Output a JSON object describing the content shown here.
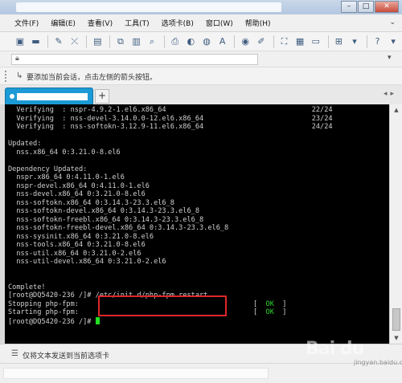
{
  "window": {
    "minimize": "–",
    "maximize": "□",
    "close": "✕"
  },
  "menu": {
    "items": [
      "文件(F)",
      "编辑(E)",
      "查看(V)",
      "工具(T)",
      "选项卡(B)",
      "窗口(W)",
      "帮助(H)"
    ]
  },
  "toolbar": {
    "icons": [
      "new-session-icon",
      "open-folder-icon",
      "reconnect-icon",
      "disconnect-icon",
      "session-properties-icon",
      "copy-icon",
      "paste-icon",
      "find-icon",
      "print-icon",
      "color-scheme-icon",
      "globe-icon",
      "font-icon",
      "lock-icon",
      "compose-icon",
      "fullscreen-icon",
      "tile-icon",
      "new-tab-icon",
      "help-icon"
    ]
  },
  "hint": {
    "text": "要添加当前会话，点击左侧的箭头按钮。"
  },
  "tabs": {
    "add": "+"
  },
  "terminal": {
    "lines": [
      "  Verifying  : nspr-4.9.2-1.el6.x86_64                                   22/24",
      "  Verifying  : nss-devel-3.14.0.0-12.el6.x86_64                          23/24",
      "  Verifying  : nss-softokn-3.12.9-11.el6.x86_64                          24/24",
      "",
      "Updated:",
      "  nss.x86_64 0:3.21.0-8.el6",
      "",
      "Dependency Updated:",
      "  nspr.x86_64 0:4.11.0-1.el6",
      "  nspr-devel.x86_64 0:4.11.0-1.el6",
      "  nss-devel.x86_64 0:3.21.0-8.el6",
      "  nss-softokn.x86_64 0:3.14.3-23.3.el6_8",
      "  nss-softokn-devel.x86_64 0:3.14.3-23.3.el6_8",
      "  nss-softokn-freebl.x86_64 0:3.14.3-23.3.el6_8",
      "  nss-softokn-freebl-devel.x86_64 0:3.14.3-23.3.el6_8",
      "  nss-sysinit.x86_64 0:3.21.0-8.el6",
      "  nss-tools.x86_64 0:3.21.0-8.el6",
      "  nss-util.x86_64 0:3.21.0-2.el6",
      "  nss-util-devel.x86_64 0:3.21.0-2.el6",
      "",
      "",
      "Complete!",
      "[root@DQ5420-236 /]# /etc/init.d/php-fpm restart"
    ],
    "ok_lines": [
      {
        "label": "Stopping php-fpm:",
        "open": "[  ",
        "status": "OK",
        "close": "  ]"
      },
      {
        "label": "Starting php-fpm:",
        "open": "[  ",
        "status": "OK",
        "close": "  ]"
      }
    ],
    "prompt": "[root@DQ5420-236 /]# ",
    "colors": {
      "background": "#000000",
      "text": "#d0d0d0",
      "ok": "#2fd32f",
      "highlight": "#e0262b"
    }
  },
  "send": {
    "text": "仅将文本发送到当前选项卡"
  },
  "watermark": {
    "main": "Bai du",
    "sub": "jingyan.baidu.com"
  }
}
